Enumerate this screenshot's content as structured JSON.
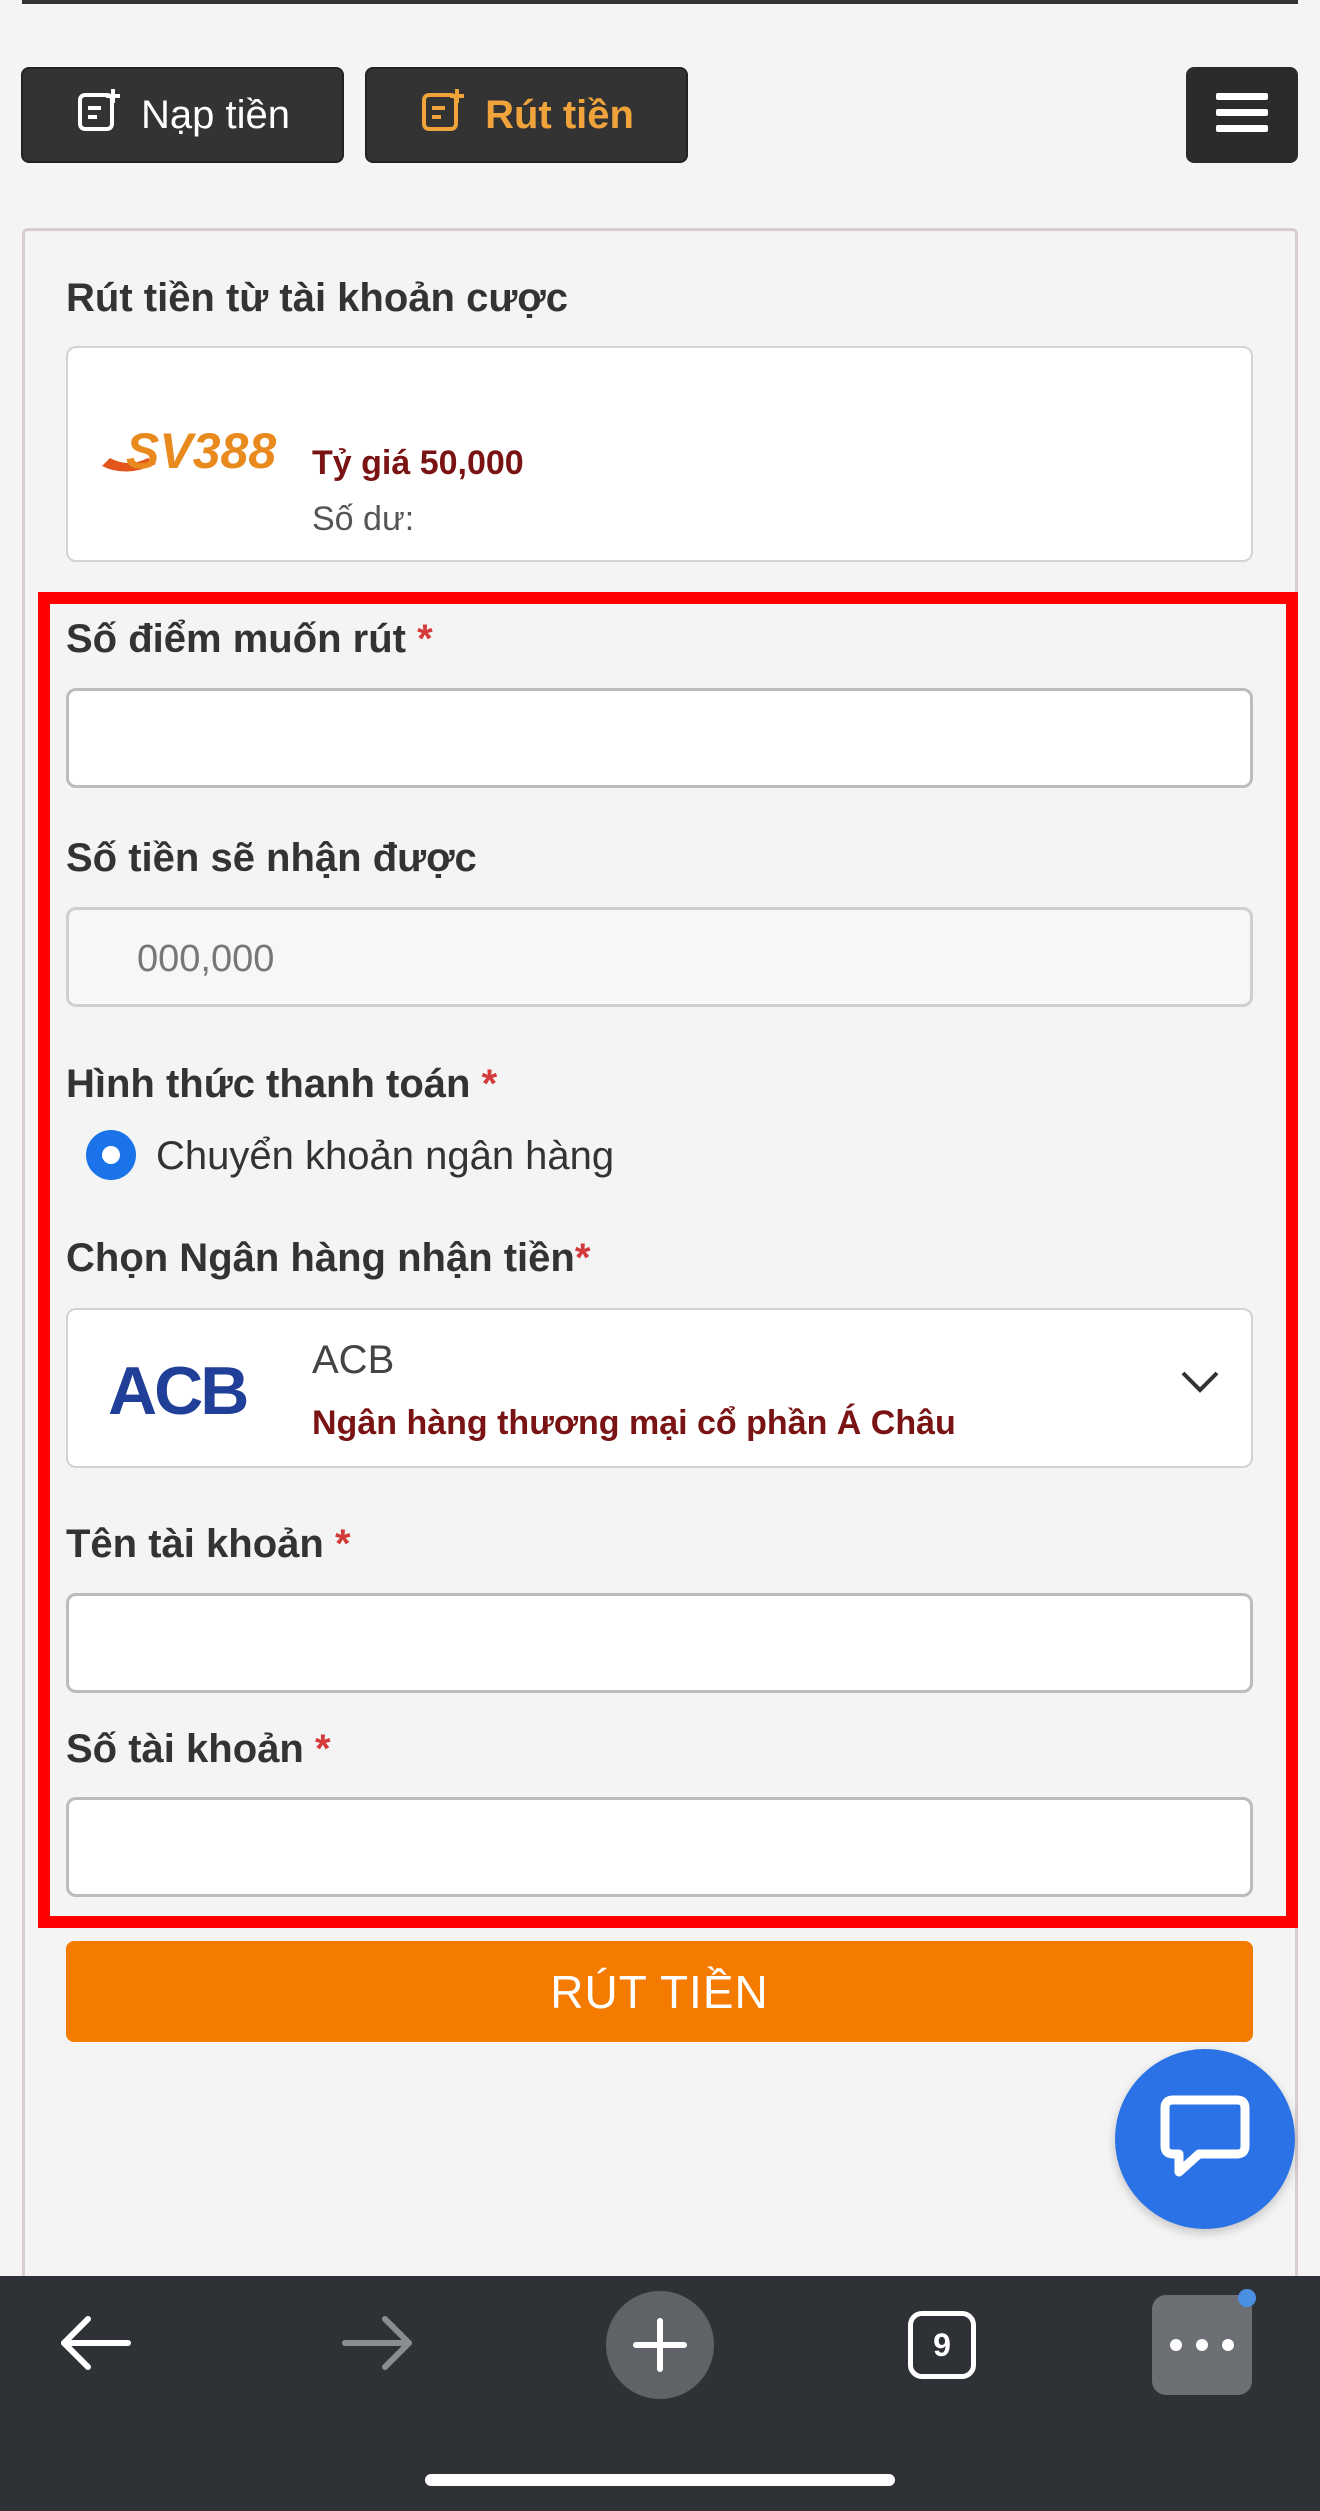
{
  "tabs": {
    "deposit_label": "Nạp tiền",
    "withdraw_label": "Rút tiền"
  },
  "card": {
    "title": "Rút tiền từ tài khoản cược",
    "account": {
      "logo_text": "SV388",
      "rate_label": "Tỷ giá 50,000",
      "balance_label": "Số dư:"
    }
  },
  "form": {
    "points_label": "Số điểm muốn rút",
    "receive_label": "Số tiền sẽ nhận được",
    "receive_placeholder": "000,000",
    "payment_label": "Hình thức thanh toán",
    "payment_option": "Chuyển khoản ngân hàng",
    "bank_label": "Chọn Ngân hàng nhận tiền",
    "bank": {
      "logo_text": "ACB",
      "code": "ACB",
      "name": "Ngân hàng thương mại cổ phần Á Châu"
    },
    "account_name_label": "Tên tài khoản",
    "account_number_label": "Số tài khoản",
    "required_mark": "*",
    "submit_label": "RÚT TIỀN"
  },
  "browser": {
    "tab_count": "9"
  },
  "colors": {
    "accent": "#f47a00",
    "highlight": "#ff0000",
    "chat": "#2a72e5",
    "dark_red": "#7a1414"
  }
}
